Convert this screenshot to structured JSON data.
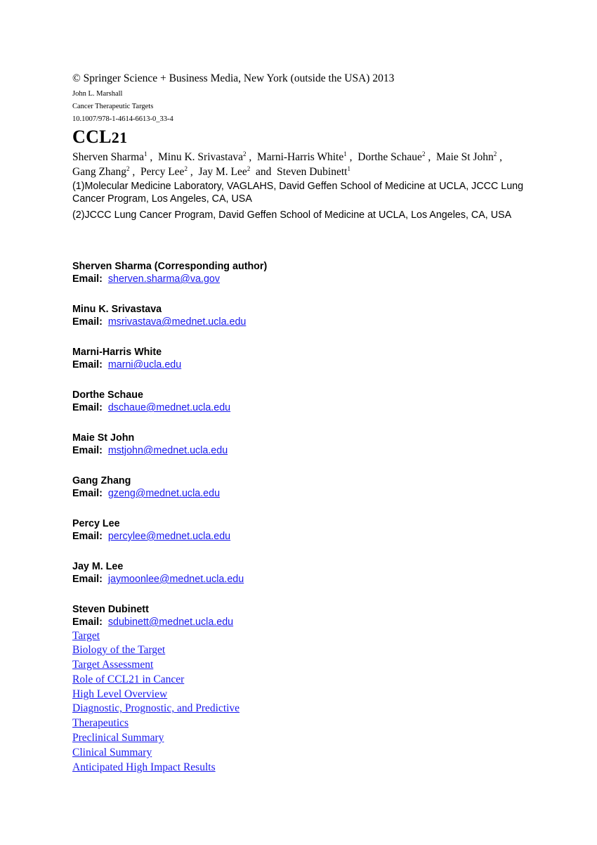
{
  "header": {
    "copyright": "© Springer Science + Business Media, New York (outside the USA) 2013",
    "editor": "John L. Marshall",
    "book_title": "Cancer Therapeutic Targets",
    "doi": "10.1007/978-1-4614-6613-0_33-4"
  },
  "title": {
    "letters": "CCL",
    "number": "21"
  },
  "authors": [
    {
      "name": "Sherven Sharma",
      "affil": "1"
    },
    {
      "name": "Minu K. Srivastava",
      "affil": "2"
    },
    {
      "name": "Marni-Harris White",
      "affil": "1"
    },
    {
      "name": "Dorthe Schaue",
      "affil": "2"
    },
    {
      "name": "Maie St John",
      "affil": "2"
    },
    {
      "name": "Gang Zhang",
      "affil": "2"
    },
    {
      "name": "Percy Lee",
      "affil": "2"
    },
    {
      "name": "Jay M. Lee",
      "affil": "2"
    },
    {
      "name": "Steven Dubinett",
      "affil": "1"
    }
  ],
  "authors_conjunction": "and",
  "affiliations": [
    "(1)Molecular Medicine Laboratory, VAGLAHS, David Geffen School of Medicine at UCLA, JCCC Lung Cancer Program, Los Angeles, CA, USA",
    "(2)JCCC Lung Cancer Program, David Geffen School of Medicine at UCLA, Los Angeles, CA, USA"
  ],
  "email_label": "Email:",
  "contacts": [
    {
      "name": "Sherven Sharma (Corresponding author)",
      "email": "sherven.sharma@va.gov"
    },
    {
      "name": "Minu K. Srivastava",
      "email": "msrivastava@mednet.ucla.edu"
    },
    {
      "name": "Marni-Harris White",
      "email": "marni@ucla.edu"
    },
    {
      "name": "Dorthe Schaue",
      "email": "dschaue@mednet.ucla.edu"
    },
    {
      "name": "Maie St John",
      "email": "mstjohn@mednet.ucla.edu"
    },
    {
      "name": "Gang Zhang",
      "email": "gzeng@mednet.ucla.edu"
    },
    {
      "name": "Percy Lee",
      "email": "percylee@mednet.ucla.edu"
    },
    {
      "name": "Jay M. Lee",
      "email": "jaymoonlee@mednet.ucla.edu"
    },
    {
      "name": "Steven Dubinett",
      "email": "sdubinett@mednet.ucla.edu"
    }
  ],
  "toc": [
    "Target",
    "Biology of the Target",
    "Target Assessment",
    "Role of CCL21 in Cancer",
    "High Level Overview",
    "Diagnostic, Prognostic, and Predictive",
    "Therapeutics",
    "Preclinical Summary",
    "Clinical Summary",
    "Anticipated High Impact Results"
  ],
  "colors": {
    "link": "#1a1aee",
    "text": "#000000"
  }
}
